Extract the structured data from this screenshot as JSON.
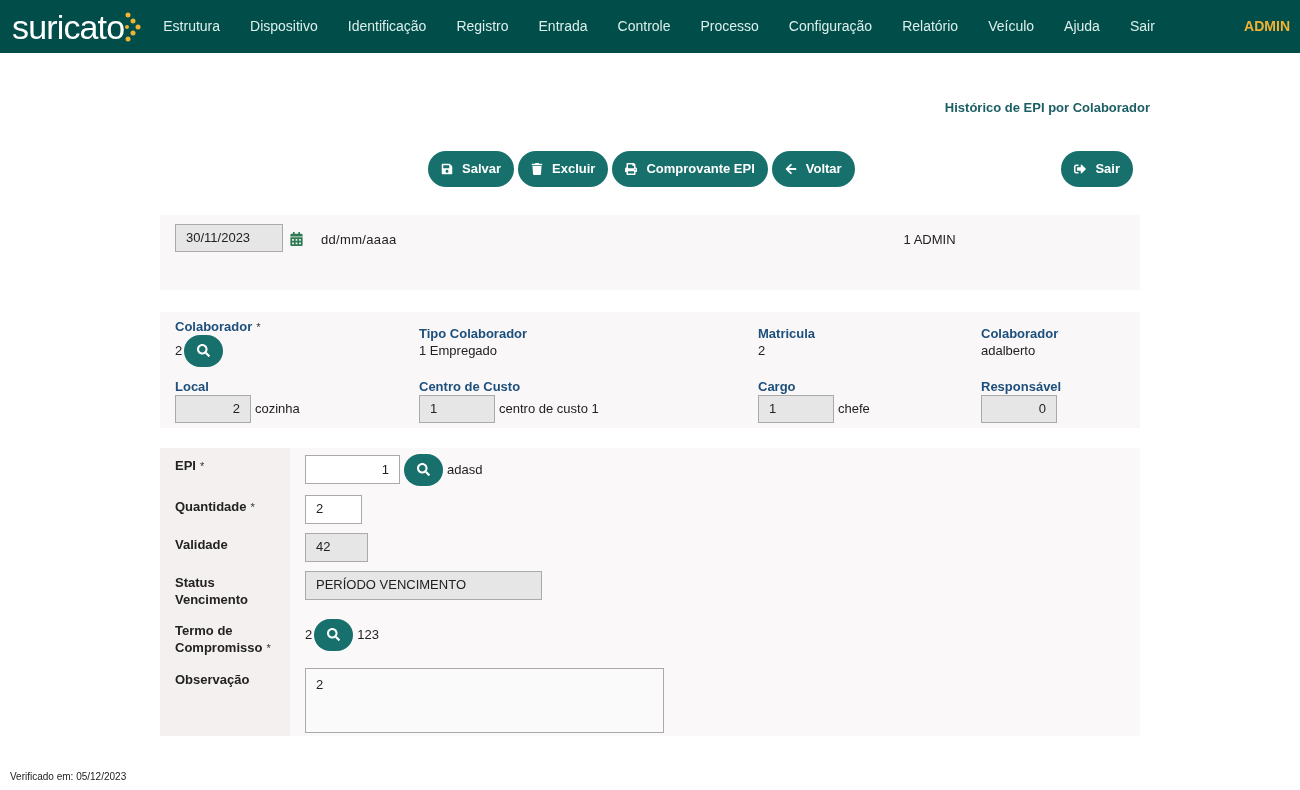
{
  "nav": {
    "logo": "suricato",
    "items": [
      "Estrutura",
      "Dispositivo",
      "Identificação",
      "Registro",
      "Entrada",
      "Controle",
      "Processo",
      "Configuração",
      "Relatório",
      "Veículo",
      "Ajuda",
      "Sair"
    ],
    "user": "ADMIN"
  },
  "page_title": "Histórico de EPI por Colaborador",
  "toolbar": [
    {
      "label": "Salvar",
      "kind": "save"
    },
    {
      "label": "Excluir",
      "kind": "delete"
    },
    {
      "label": "Comprovante EPI",
      "kind": "print"
    },
    {
      "label": "Voltar",
      "kind": "back"
    }
  ],
  "exit_button": {
    "label": "Sair"
  },
  "header": {
    "date": "30/11/2023",
    "date_hint": "dd/mm/aaaa",
    "user": "1 ADMIN"
  },
  "collaborator": [
    {
      "label": "Colaborador",
      "mark": "*",
      "kind": "lookup",
      "value": "2"
    },
    {
      "label": "Tipo Colaborador",
      "kind": "text",
      "value": "1 Empregado"
    },
    {
      "label": "Matricula",
      "kind": "text",
      "value": "2"
    },
    {
      "label": "Colaborador",
      "kind": "text",
      "value": "adalberto"
    },
    {
      "label": "Local",
      "kind": "number_field",
      "value": "2",
      "description": "cozinha"
    },
    {
      "label": "Centro de Custo",
      "kind": "text_field",
      "value": "1",
      "description": "centro de custo 1"
    },
    {
      "label": "Cargo",
      "kind": "text_field",
      "value": "1",
      "description": "chefe"
    },
    {
      "label": "Responsável",
      "kind": "number_field",
      "value": "0"
    }
  ],
  "form": [
    {
      "label": "EPI",
      "mark": "*",
      "kind": "input_lookup",
      "value": "1",
      "description": "adasd"
    },
    {
      "label": "Quantidade",
      "mark": "*",
      "kind": "input",
      "value": "2"
    },
    {
      "label": "Validade",
      "kind": "readonly",
      "value": "42"
    },
    {
      "label": "Status Vencimento",
      "kind": "readonly_wide",
      "value": "PERÍODO VENCIMENTO"
    },
    {
      "label": "Termo de Compromisso",
      "mark": "*",
      "kind": "lookup",
      "value": "2",
      "description": "123"
    },
    {
      "label": "Observação",
      "kind": "textarea",
      "value": "2"
    }
  ],
  "footer": "Verificado em: 05/12/2023"
}
